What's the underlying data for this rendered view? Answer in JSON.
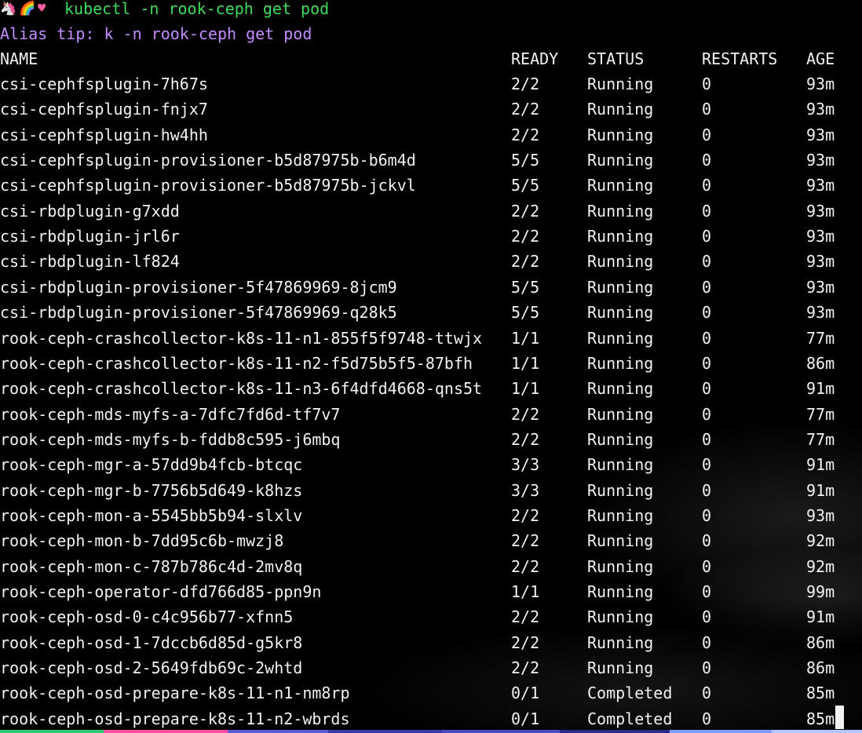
{
  "prompt": {
    "icons": [
      "unicorn-icon",
      "rainbow-icon",
      "heart-icon"
    ],
    "command": "kubectl -n rook-ceph get pod"
  },
  "alias_tip": "Alias tip: k -n rook-ceph get pod",
  "table": {
    "headers": {
      "name": "NAME",
      "ready": "READY",
      "status": "STATUS",
      "restarts": "RESTARTS",
      "age": "AGE"
    },
    "rows": [
      {
        "name": "csi-cephfsplugin-7h67s",
        "ready": "2/2",
        "status": "Running",
        "restarts": "0",
        "age": "93m"
      },
      {
        "name": "csi-cephfsplugin-fnjx7",
        "ready": "2/2",
        "status": "Running",
        "restarts": "0",
        "age": "93m"
      },
      {
        "name": "csi-cephfsplugin-hw4hh",
        "ready": "2/2",
        "status": "Running",
        "restarts": "0",
        "age": "93m"
      },
      {
        "name": "csi-cephfsplugin-provisioner-b5d87975b-b6m4d",
        "ready": "5/5",
        "status": "Running",
        "restarts": "0",
        "age": "93m"
      },
      {
        "name": "csi-cephfsplugin-provisioner-b5d87975b-jckvl",
        "ready": "5/5",
        "status": "Running",
        "restarts": "0",
        "age": "93m"
      },
      {
        "name": "csi-rbdplugin-g7xdd",
        "ready": "2/2",
        "status": "Running",
        "restarts": "0",
        "age": "93m"
      },
      {
        "name": "csi-rbdplugin-jrl6r",
        "ready": "2/2",
        "status": "Running",
        "restarts": "0",
        "age": "93m"
      },
      {
        "name": "csi-rbdplugin-lf824",
        "ready": "2/2",
        "status": "Running",
        "restarts": "0",
        "age": "93m"
      },
      {
        "name": "csi-rbdplugin-provisioner-5f47869969-8jcm9",
        "ready": "5/5",
        "status": "Running",
        "restarts": "0",
        "age": "93m"
      },
      {
        "name": "csi-rbdplugin-provisioner-5f47869969-q28k5",
        "ready": "5/5",
        "status": "Running",
        "restarts": "0",
        "age": "93m"
      },
      {
        "name": "rook-ceph-crashcollector-k8s-11-n1-855f5f9748-ttwjx",
        "ready": "1/1",
        "status": "Running",
        "restarts": "0",
        "age": "77m"
      },
      {
        "name": "rook-ceph-crashcollector-k8s-11-n2-f5d75b5f5-87bfh",
        "ready": "1/1",
        "status": "Running",
        "restarts": "0",
        "age": "86m"
      },
      {
        "name": "rook-ceph-crashcollector-k8s-11-n3-6f4dfd4668-qns5t",
        "ready": "1/1",
        "status": "Running",
        "restarts": "0",
        "age": "91m"
      },
      {
        "name": "rook-ceph-mds-myfs-a-7dfc7fd6d-tf7v7",
        "ready": "2/2",
        "status": "Running",
        "restarts": "0",
        "age": "77m"
      },
      {
        "name": "rook-ceph-mds-myfs-b-fddb8c595-j6mbq",
        "ready": "2/2",
        "status": "Running",
        "restarts": "0",
        "age": "77m"
      },
      {
        "name": "rook-ceph-mgr-a-57dd9b4fcb-btcqc",
        "ready": "3/3",
        "status": "Running",
        "restarts": "0",
        "age": "91m"
      },
      {
        "name": "rook-ceph-mgr-b-7756b5d649-k8hzs",
        "ready": "3/3",
        "status": "Running",
        "restarts": "0",
        "age": "91m"
      },
      {
        "name": "rook-ceph-mon-a-5545bb5b94-slxlv",
        "ready": "2/2",
        "status": "Running",
        "restarts": "0",
        "age": "93m"
      },
      {
        "name": "rook-ceph-mon-b-7dd95c6b-mwzj8",
        "ready": "2/2",
        "status": "Running",
        "restarts": "0",
        "age": "92m"
      },
      {
        "name": "rook-ceph-mon-c-787b786c4d-2mv8q",
        "ready": "2/2",
        "status": "Running",
        "restarts": "0",
        "age": "92m"
      },
      {
        "name": "rook-ceph-operator-dfd766d85-ppn9n",
        "ready": "1/1",
        "status": "Running",
        "restarts": "0",
        "age": "99m"
      },
      {
        "name": "rook-ceph-osd-0-c4c956b77-xfnn5",
        "ready": "2/2",
        "status": "Running",
        "restarts": "0",
        "age": "91m"
      },
      {
        "name": "rook-ceph-osd-1-7dccb6d85d-g5kr8",
        "ready": "2/2",
        "status": "Running",
        "restarts": "0",
        "age": "86m"
      },
      {
        "name": "rook-ceph-osd-2-5649fdb69c-2whtd",
        "ready": "2/2",
        "status": "Running",
        "restarts": "0",
        "age": "86m"
      },
      {
        "name": "rook-ceph-osd-prepare-k8s-11-n1-nm8rp",
        "ready": "0/1",
        "status": "Completed",
        "restarts": "0",
        "age": "85m"
      },
      {
        "name": "rook-ceph-osd-prepare-k8s-11-n2-wbrds",
        "ready": "0/1",
        "status": "Completed",
        "restarts": "0",
        "age": "85m"
      }
    ]
  },
  "colors": {
    "background": "#000000",
    "text": "#f2f2f2",
    "command": "#3ddc5f",
    "alias_tip": "#c38cff",
    "bottom_bar": [
      "#2ecc71",
      "#ff4fa0",
      "#5b5bd6",
      "#3a3aa8",
      "#4b4bc0",
      "#2a2a8a",
      "#7f9cff",
      "#b7c7ff"
    ]
  }
}
